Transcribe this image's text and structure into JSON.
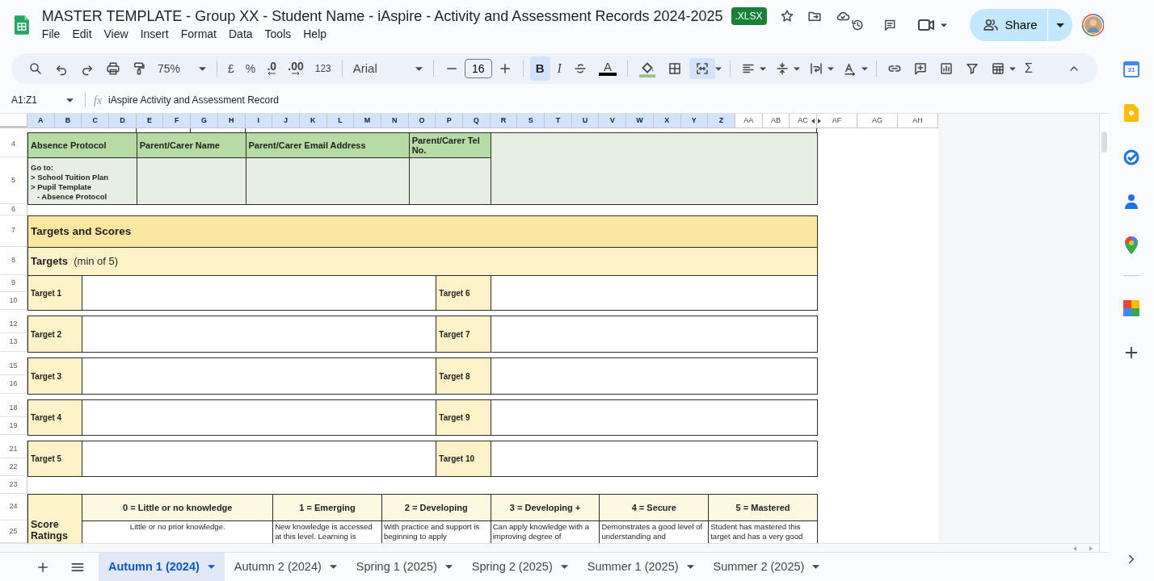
{
  "app": {
    "title": "MASTER TEMPLATE - Group XX - Student Name - iAspire - Activity and Assessment Records 2024-2025",
    "badge": ".XLSX",
    "share": "Share"
  },
  "menu": [
    "File",
    "Edit",
    "View",
    "Insert",
    "Format",
    "Data",
    "Tools",
    "Help"
  ],
  "toolbar": {
    "zoom": "75%",
    "currency": "£",
    "percent": "%",
    "decrease_decimals": ".0",
    "increase_decimals": ".00",
    "number_formats": "123",
    "font": "Arial",
    "font_size": "16",
    "bold": "B",
    "italic": "I",
    "text_color": "A",
    "sum": "Σ",
    "bold_on": true,
    "merge_on": true
  },
  "formula_bar": {
    "cell_range": "A1:Z1",
    "fx": "fx",
    "formula": "iAspire Activity and Assessment Record"
  },
  "columns": [
    {
      "label": "A",
      "selected": true
    },
    {
      "label": "B",
      "selected": true
    },
    {
      "label": "C",
      "selected": true
    },
    {
      "label": "D",
      "selected": true
    },
    {
      "label": "E",
      "selected": true
    },
    {
      "label": "F",
      "selected": true
    },
    {
      "label": "G",
      "selected": true
    },
    {
      "label": "H",
      "selected": true
    },
    {
      "label": "I",
      "selected": true
    },
    {
      "label": "J",
      "selected": true
    },
    {
      "label": "K",
      "selected": true
    },
    {
      "label": "L",
      "selected": true
    },
    {
      "label": "M",
      "selected": true
    },
    {
      "label": "N",
      "selected": true
    },
    {
      "label": "O",
      "selected": true
    },
    {
      "label": "P",
      "selected": true
    },
    {
      "label": "Q",
      "selected": true
    },
    {
      "label": "R",
      "selected": true
    },
    {
      "label": "S",
      "selected": true
    },
    {
      "label": "T",
      "selected": true
    },
    {
      "label": "U",
      "selected": true
    },
    {
      "label": "V",
      "selected": true
    },
    {
      "label": "W",
      "selected": true
    },
    {
      "label": "X",
      "selected": true
    },
    {
      "label": "Y",
      "selected": true
    },
    {
      "label": "Z",
      "selected": true
    },
    {
      "label": "AA",
      "selected": false
    },
    {
      "label": "AB",
      "selected": false
    },
    {
      "label": "AC",
      "selected": false
    },
    {
      "label": "AF",
      "selected": false
    },
    {
      "label": "AG",
      "selected": false
    },
    {
      "label": "AH",
      "selected": false
    }
  ],
  "row_numbers": [
    "4",
    "5",
    "6",
    "7",
    "8",
    "9",
    "10",
    "12",
    "13",
    "15",
    "16",
    "18",
    "19",
    "21",
    "22",
    "23",
    "24",
    "25"
  ],
  "sheet": {
    "contact_headers": [
      "Absence Protocol",
      "Parent/Carer Name",
      "Parent/Carer Email Address",
      "Parent/Carer Tel No."
    ],
    "absence_note": "Go to:\n> School Tuition Plan\n> Pupil Template\n   - Absence Protocol",
    "section_title": "Targets and Scores",
    "targets_heading": "**Targets**  (min of 5)",
    "targets": [
      "Target 1",
      "Target 2",
      "Target 3",
      "Target 4",
      "Target 5",
      "Target 6",
      "Target 7",
      "Target 8",
      "Target 9",
      "Target 10"
    ],
    "score_label": "Score Ratings",
    "scores": [
      {
        "heading": "0 = Little or no knowledge",
        "description": "Little or no prior knowledge."
      },
      {
        "heading": "1 = Emerging",
        "description": "New knowledge is accessed at this level. Learning is"
      },
      {
        "heading": "2 = Developing",
        "description": "With practice and support is beginning to apply"
      },
      {
        "heading": "3 = Developing +",
        "description": "Can apply knowledge with a improving degree of"
      },
      {
        "heading": "4 = Secure",
        "description": "Demonstrates a good level of understanding and"
      },
      {
        "heading": "5 = Mastered",
        "description": "Student has mastered this target and has a very good"
      }
    ]
  },
  "sheet_tabs": [
    {
      "label": "Autumn 1 (2024)",
      "selected": true
    },
    {
      "label": "Autumn 2 (2024)",
      "selected": false
    },
    {
      "label": "Spring 1 (2025)",
      "selected": false
    },
    {
      "label": "Spring 2 (2025)",
      "selected": false
    },
    {
      "label": "Summer 1 (2025)",
      "selected": false
    },
    {
      "label": "Summer 2 (2025)",
      "selected": false
    }
  ],
  "side_panel": {
    "calendar_day": "31"
  }
}
